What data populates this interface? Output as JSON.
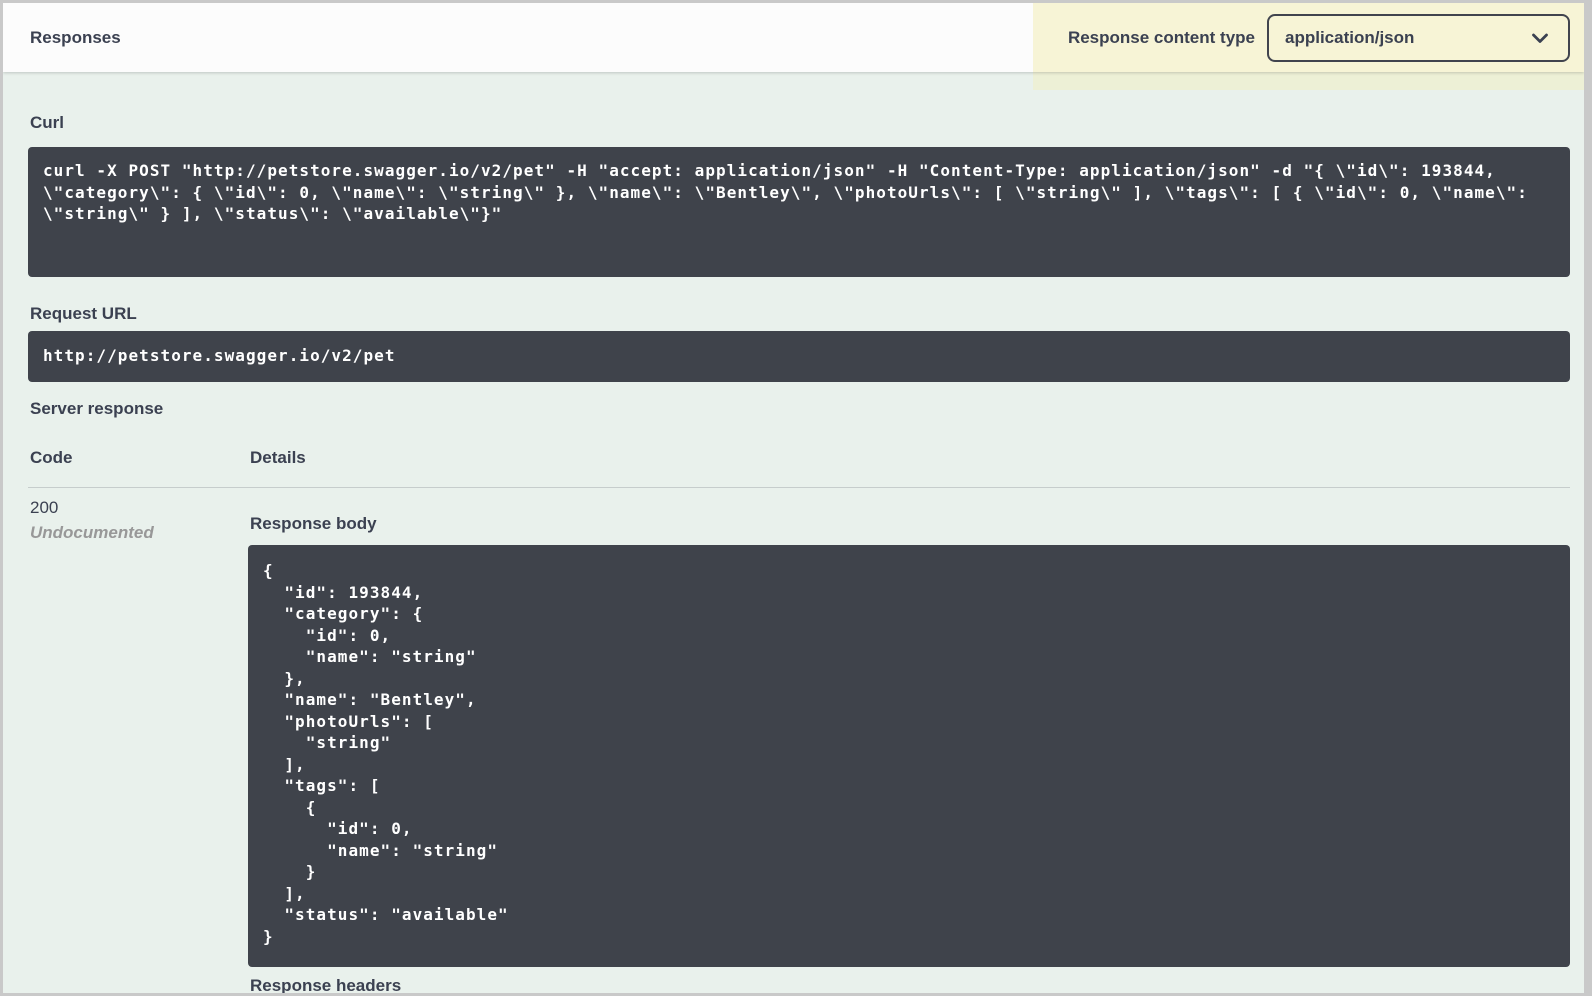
{
  "header": {
    "title": "Responses",
    "content_type_label": "Response content type",
    "content_type_value": "application/json"
  },
  "curl": {
    "label": "Curl",
    "command": "curl -X POST \"http://petstore.swagger.io/v2/pet\" -H \"accept: application/json\" -H \"Content-Type: application/json\" -d \"{ \\\"id\\\": 193844, \\\"category\\\": { \\\"id\\\": 0, \\\"name\\\": \\\"string\\\" }, \\\"name\\\": \\\"Bentley\\\", \\\"photoUrls\\\": [ \\\"string\\\" ], \\\"tags\\\": [ { \\\"id\\\": 0, \\\"name\\\": \\\"string\\\" } ], \\\"status\\\": \\\"available\\\"}\""
  },
  "request_url": {
    "label": "Request URL",
    "url": "http://petstore.swagger.io/v2/pet"
  },
  "server_response": {
    "label": "Server response",
    "col_code": "Code",
    "col_details": "Details",
    "code": "200",
    "code_note": "Undocumented",
    "response_body_label": "Response body",
    "response_body": "{\n  \"id\": 193844,\n  \"category\": {\n    \"id\": 0,\n    \"name\": \"string\"\n  },\n  \"name\": \"Bentley\",\n  \"photoUrls\": [\n    \"string\"\n  ],\n  \"tags\": [\n    {\n      \"id\": 0,\n      \"name\": \"string\"\n    }\n  ],\n  \"status\": \"available\"\n}",
    "response_headers_label": "Response headers"
  },
  "colors": {
    "panel_green": "#e9f1ec",
    "code_block": "#3f434b",
    "highlight_yellow": "#f7f4d6",
    "heading_text": "#3b4151"
  }
}
